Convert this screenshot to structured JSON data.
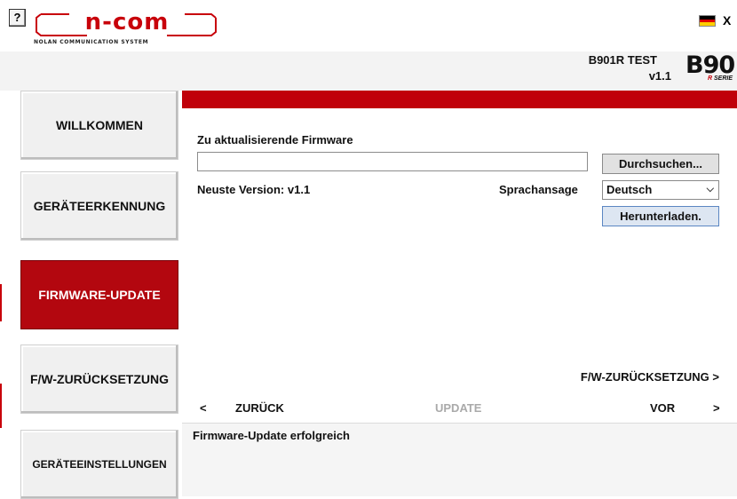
{
  "window": {
    "help_label": "?",
    "close_label": "X",
    "logo": {
      "title": "n-com",
      "subtitle": "NOLAN COMMUNICATION SYSTEM"
    },
    "flag": "german-flag-icon",
    "accent_color": "#c0000a"
  },
  "device": {
    "name": "B901R TEST",
    "version": "v1.1",
    "brand": "B90",
    "brand_sub_r": "R",
    "brand_sub": "SERIE"
  },
  "sidebar": {
    "items": [
      {
        "label": "WILLKOMMEN",
        "active": false
      },
      {
        "label": "GERÄTEERKENNUNG",
        "active": false
      },
      {
        "label": "FIRMWARE-UPDATE",
        "active": true
      },
      {
        "label": "F/W-ZURÜCKSETZUNG",
        "active": false
      },
      {
        "label": "GERÄTEEINSTELLUNGEN",
        "active": false
      }
    ]
  },
  "firmware": {
    "heading": "Zu aktualisierende Firmware",
    "file_value": "",
    "browse_label": "Durchsuchen...",
    "latest_version": "Neuste Version: v1.1",
    "voice_label": "Sprachansage",
    "voice_selected": "Deutsch",
    "download_label": "Herunterladen."
  },
  "footer_nav": {
    "reset_link": "F/W-ZURÜCKSETZUNG  >",
    "back_arrow": "<",
    "back_label": "ZURÜCK",
    "update_label": "UPDATE",
    "forward_label": "VOR",
    "forward_arrow": ">"
  },
  "status": {
    "message": "Firmware-Update erfolgreich"
  }
}
